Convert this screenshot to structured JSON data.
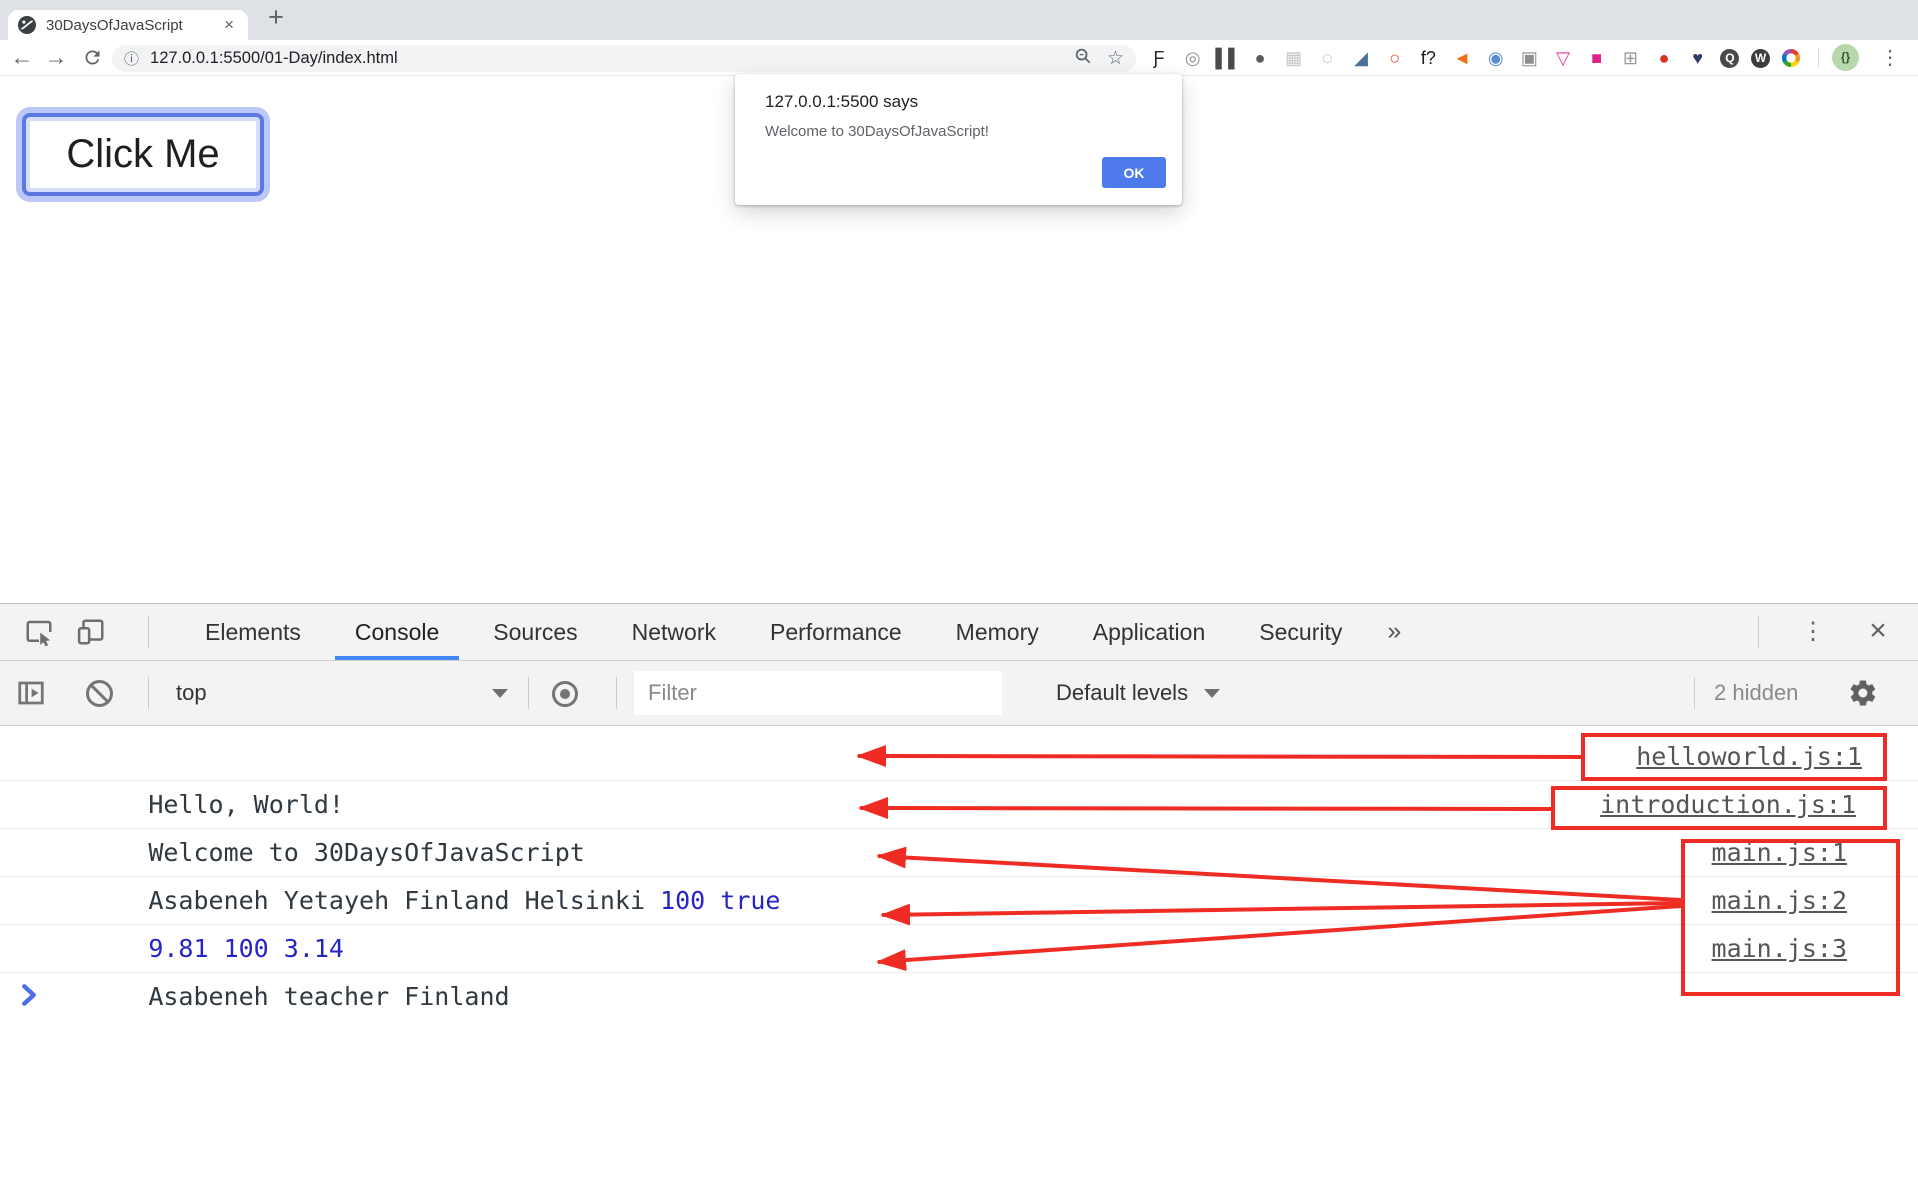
{
  "browser": {
    "tab_title": "30DaysOfJavaScript",
    "url": "127.0.0.1:5500/01-Day/index.html",
    "extensions": [
      {
        "name": "script-f",
        "glyph": "Ƒ",
        "fg": "#2a2a2a"
      },
      {
        "name": "orbit",
        "glyph": "◎",
        "fg": "#8f8f8f"
      },
      {
        "name": "pause-bars",
        "glyph": "▌▌",
        "fg": "#4a4a4a"
      },
      {
        "name": "bug",
        "glyph": "●",
        "fg": "#5a5a5a"
      },
      {
        "name": "light-grid",
        "glyph": "▦",
        "fg": "#c6c6c6"
      },
      {
        "name": "dotted-circle",
        "glyph": "◌",
        "fg": "#9a9a9a"
      },
      {
        "name": "eyedropper",
        "glyph": "◢",
        "fg": "#4a7296"
      },
      {
        "name": "red-ring",
        "glyph": "○",
        "fg": "#e8432f"
      },
      {
        "name": "f-question",
        "glyph": "f?",
        "fg": "#1a1a1a"
      },
      {
        "name": "megaphone",
        "glyph": "◄",
        "fg": "#f07018"
      },
      {
        "name": "blue-orb",
        "glyph": "◉",
        "fg": "#5d8bd0"
      },
      {
        "name": "camera",
        "glyph": "▣",
        "fg": "#8f8f8f"
      },
      {
        "name": "pink-flask",
        "glyph": "▽",
        "fg": "#e8359b"
      },
      {
        "name": "magenta-badge",
        "glyph": "■",
        "fg": "#e0218a"
      },
      {
        "name": "gray-cube",
        "glyph": "⊞",
        "fg": "#9a9a9a"
      },
      {
        "name": "red-orb",
        "glyph": "●",
        "fg": "#d93025"
      },
      {
        "name": "navy-heart",
        "glyph": "♥",
        "fg": "#2c3e66"
      },
      {
        "name": "q-badge",
        "glyph": "Q",
        "fg": "#ffffff",
        "bg": "#4a4a4a"
      },
      {
        "name": "w-badge",
        "glyph": "W",
        "fg": "#ffffff",
        "bg": "#3d3d3d"
      },
      {
        "name": "rainbow-ring",
        "type": "rainbow"
      }
    ]
  },
  "icons": {
    "new_tab": "+",
    "tab_close": "×",
    "back": "←",
    "forward": "→",
    "bookmark_star": "☆",
    "url_info": "ⓘ",
    "browser_menu": "⋮",
    "avatar": "{}",
    "devtools_more_tabs": "»",
    "devtools_menu": "⋮",
    "devtools_close": "×",
    "prompt": "chevron-right"
  },
  "page": {
    "button_label": "Click Me"
  },
  "dialog": {
    "title": "127.0.0.1:5500 says",
    "message": "Welcome to 30DaysOfJavaScript!",
    "ok_label": "OK"
  },
  "devtools": {
    "tabs": [
      {
        "label": "Elements"
      },
      {
        "label": "Console"
      },
      {
        "label": "Sources"
      },
      {
        "label": "Network"
      },
      {
        "label": "Performance"
      },
      {
        "label": "Memory"
      },
      {
        "label": "Application"
      },
      {
        "label": "Security"
      }
    ],
    "active_tab": "Console",
    "toolbar": {
      "context": "top",
      "filter_placeholder": "Filter",
      "levels": "Default levels",
      "hidden": "2 hidden"
    },
    "console": {
      "rows": [
        {
          "text": "Hello, World!",
          "link": "helloworld.js:1"
        },
        {
          "text": "Welcome to 30DaysOfJavaScript",
          "link": "introduction.js:1"
        },
        {
          "text": "Asabeneh Yetayeh Finland Helsinki ",
          "value": "100 true",
          "link": "main.js:1"
        },
        {
          "value": "9.81 100 3.14",
          "link": "main.js:2"
        },
        {
          "text": "Asabeneh teacher Finland",
          "link": "main.js:3"
        }
      ]
    }
  },
  "colors": {
    "annotation_red": "#ee2c24",
    "accent_blue": "#4285f4",
    "number_blue": "#2525c6",
    "link_gray": "#555555",
    "ok_blue": "#4d7bee",
    "prompt_blue": "#4a6fe9"
  }
}
